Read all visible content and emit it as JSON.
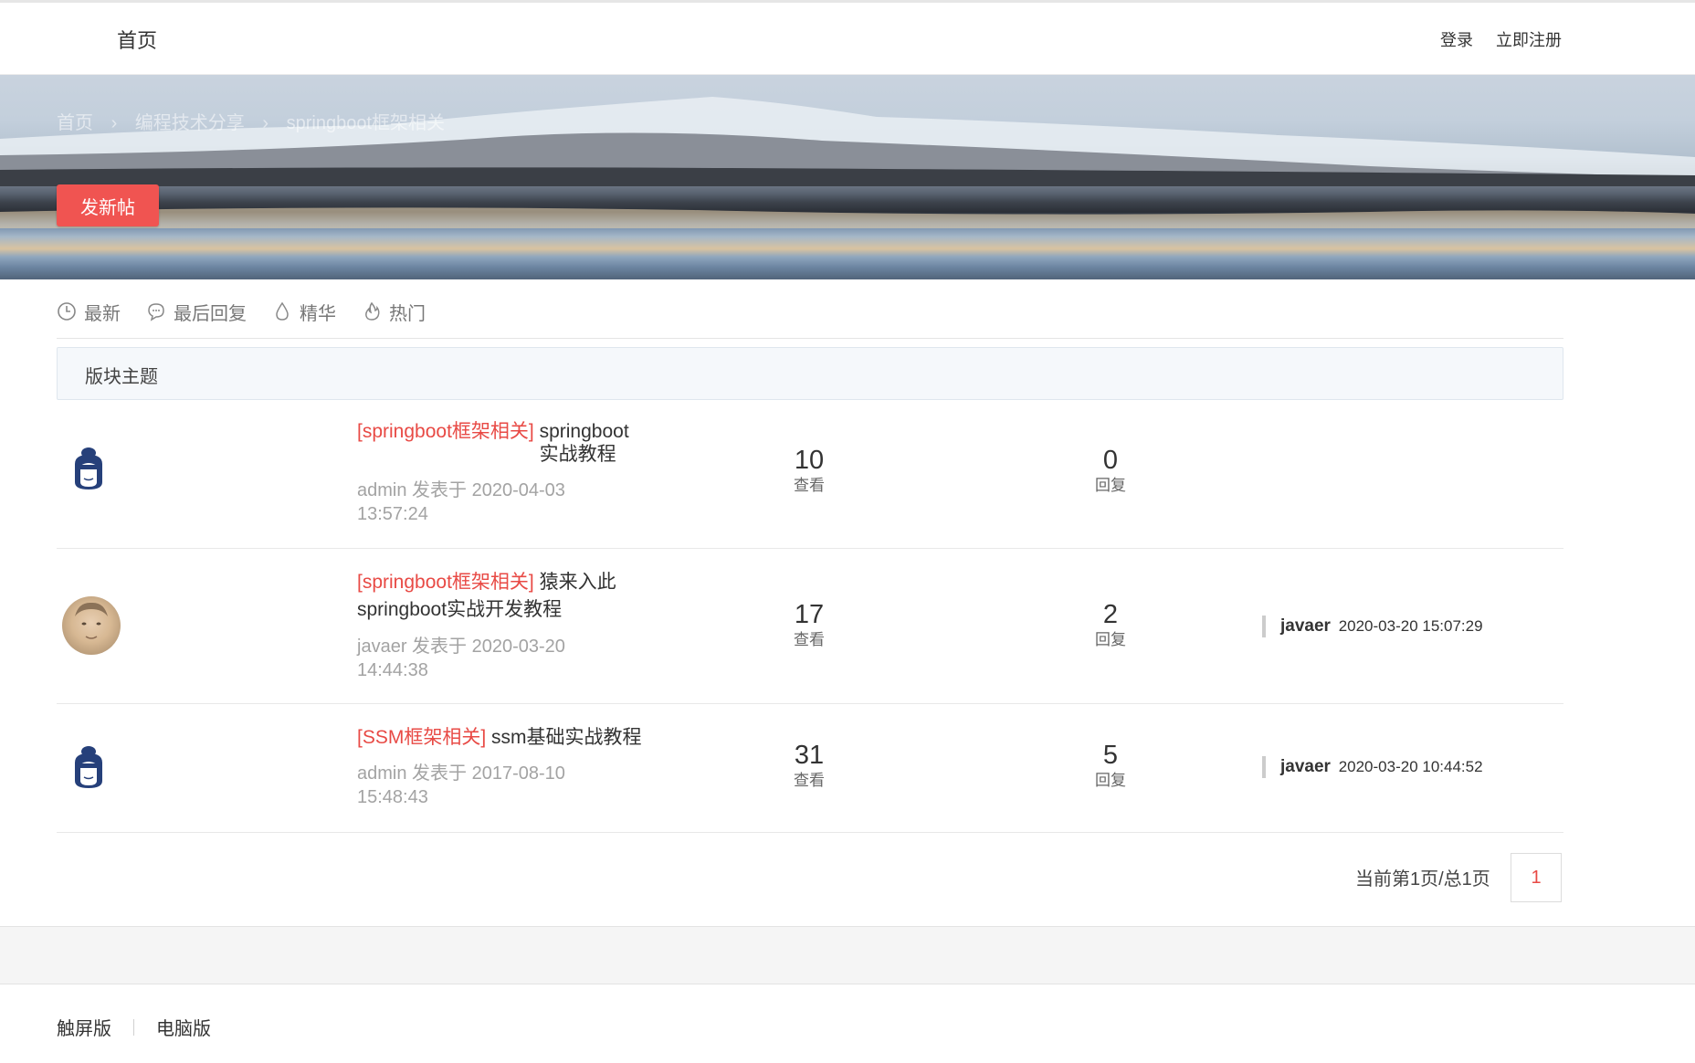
{
  "topnav": {
    "home": "首页",
    "login": "登录",
    "register": "立即注册"
  },
  "banner": {
    "breadcrumb": [
      "首页",
      "›",
      "编程技术分享",
      "›",
      "springboot框架相关"
    ],
    "new_post_label": "发新帖"
  },
  "filters": [
    {
      "label": "最新",
      "icon": "clock-icon"
    },
    {
      "label": "最后回复",
      "icon": "comment-icon"
    },
    {
      "label": "精华",
      "icon": "drop-icon"
    },
    {
      "label": "热门",
      "icon": "flame-icon"
    }
  ],
  "section_title": "版块主题",
  "threads": [
    {
      "tag": "[springboot框架相关]",
      "title_line1": "springboot",
      "title_line2": "实战教程",
      "author_meta": "admin 发表于 2020-04-03",
      "time_meta": "13:57:24",
      "views": "10",
      "views_label": "查看",
      "replies": "0",
      "replies_label": "回复",
      "avatar": "monkey-avatar-icon"
    },
    {
      "tag": "[springboot框架相关]",
      "title_line1": "猿来入此",
      "title_line2": "springboot实战开发教程",
      "author_meta": "javaer 发表于 2020-03-20",
      "time_meta": "14:44:38",
      "views": "17",
      "views_label": "查看",
      "replies": "2",
      "replies_label": "回复",
      "last_user": "javaer",
      "last_time": "2020-03-20 15:07:29",
      "avatar": "user-photo-avatar"
    },
    {
      "tag": "[SSM框架相关]",
      "title_line1": "ssm基础实战教程",
      "author_meta": "admin 发表于 2017-08-10",
      "time_meta": "15:48:43",
      "views": "31",
      "views_label": "查看",
      "replies": "5",
      "replies_label": "回复",
      "last_user": "javaer",
      "last_time": "2020-03-20 10:44:52",
      "avatar": "monkey-avatar-icon"
    }
  ],
  "pager": {
    "text": "当前第1页/总1页",
    "current": "1"
  },
  "footer": {
    "touch": "触屏版",
    "pc": "电脑版"
  },
  "colors": {
    "accent": "#f05451",
    "tag": "#e84a45",
    "section_bg": "#f5f8fb"
  }
}
